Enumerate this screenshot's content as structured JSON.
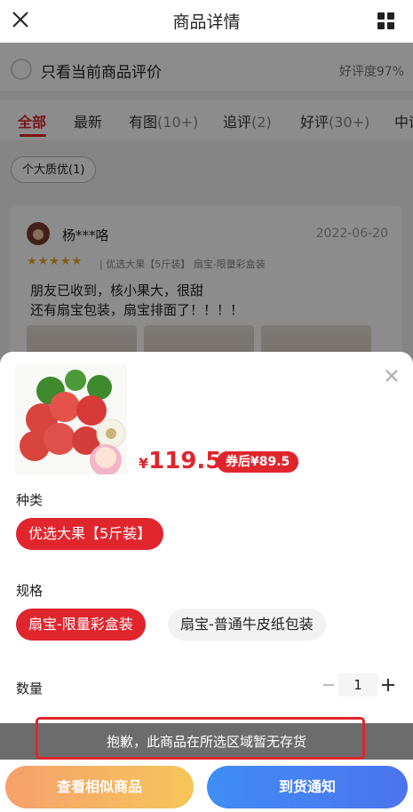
{
  "header": {
    "title": "商品详情",
    "close_icon": "close-icon",
    "menu_icon": "grid-icon"
  },
  "filters": {
    "only_current_label": "只看当前商品评价",
    "positive_rate": "好评度97%"
  },
  "tabs": [
    {
      "label": "全部",
      "count": ""
    },
    {
      "label": "最新",
      "count": ""
    },
    {
      "label": "有图",
      "count": "(10+)"
    },
    {
      "label": "追评",
      "count": "(2)"
    },
    {
      "label": "好评",
      "count": "(30+)"
    },
    {
      "label": "中评",
      "count": ""
    }
  ],
  "tag_chip": "个大质优(1)",
  "review": {
    "user": "杨***咯",
    "date": "2022-06-20",
    "stars": "★★★★★",
    "spec": "| 优选大果【5斤装】  扇宝-限量彩盒装",
    "line1": "朋友已收到，核小果大，很甜",
    "line2": "还有扇宝包装，扇宝排面了！！！！"
  },
  "sheet": {
    "price_symbol": "¥",
    "price": "119.5",
    "coupon": "券后¥89.5",
    "type_label": "种类",
    "type_options": [
      "优选大果【5斤装】"
    ],
    "spec_label": "规格",
    "spec_options": [
      "扇宝-限量彩盒装",
      "扇宝-普通牛皮纸包装"
    ],
    "qty_label": "数量",
    "qty_value": "1",
    "notice": "抱歉，此商品在所选区域暂无存货",
    "btn_similar": "查看相似商品",
    "btn_notify": "到货通知"
  },
  "colors": {
    "accent": "#e0252d",
    "blue": "#3f8df5",
    "orange": "#f6a06c"
  }
}
